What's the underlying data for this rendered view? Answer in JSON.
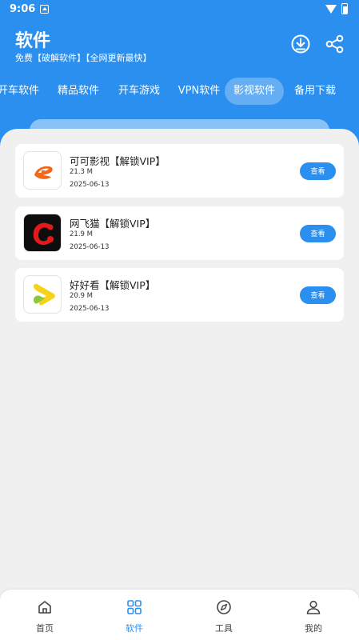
{
  "status_bar": {
    "time": "9:06"
  },
  "header": {
    "title": "软件",
    "subtitle": "免费【破解软件】【全网更新最快】"
  },
  "tabs": [
    {
      "label": "开车软件",
      "active": false
    },
    {
      "label": "精品软件",
      "active": false
    },
    {
      "label": "开车游戏",
      "active": false
    },
    {
      "label": "VPN软件",
      "active": false
    },
    {
      "label": "影视软件",
      "active": true
    },
    {
      "label": "备用下载",
      "active": false
    }
  ],
  "apps": [
    {
      "name": "可可影视【解锁VIP】",
      "size": "21.3 M",
      "date": "2025-06-13",
      "button": "查看",
      "icon": "keke-icon"
    },
    {
      "name": "网飞猫【解锁VIP】",
      "size": "21.9 M",
      "date": "2025-06-13",
      "button": "查看",
      "icon": "wangfeimao-icon"
    },
    {
      "name": "好好看【解锁VIP】",
      "size": "20.9 M",
      "date": "2025-06-13",
      "button": "查看",
      "icon": "haohaokan-icon"
    }
  ],
  "bottom_nav": [
    {
      "label": "首页",
      "icon": "home-icon",
      "active": false
    },
    {
      "label": "软件",
      "icon": "grid-icon",
      "active": true
    },
    {
      "label": "工具",
      "icon": "compass-icon",
      "active": false
    },
    {
      "label": "我的",
      "icon": "user-icon",
      "active": false
    }
  ],
  "colors": {
    "accent": "#2b8ff0",
    "background": "#f0f0f0"
  }
}
